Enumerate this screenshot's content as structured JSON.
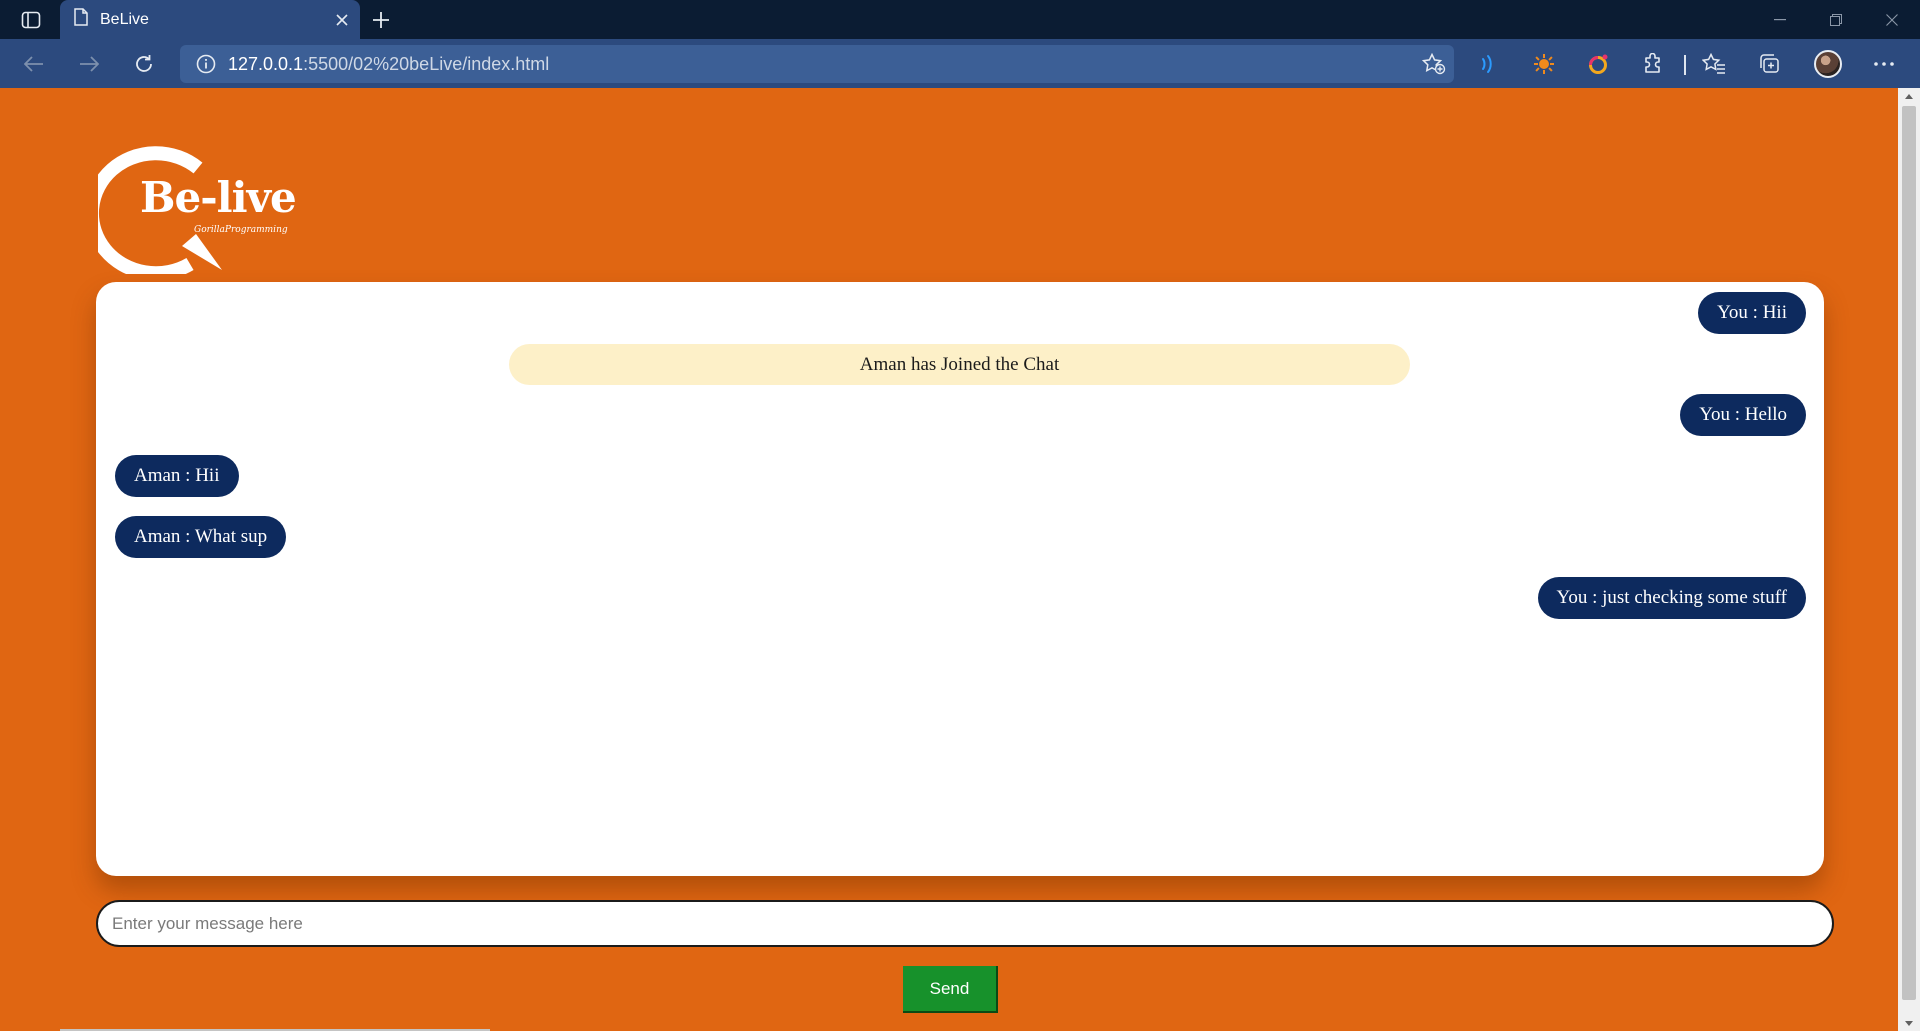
{
  "browser": {
    "tab_title": "BeLive",
    "url_host": "127.0.0.1",
    "url_path": ":5500/02%20beLive/index.html",
    "icons": [
      "tab-actions-icon",
      "page-icon",
      "close-icon",
      "plus-icon",
      "back-icon",
      "forward-icon",
      "refresh-icon",
      "info-icon",
      "add-favorite-icon",
      "read-aloud-icon",
      "extension-sun-icon",
      "extension-ring-icon",
      "extensions-icon",
      "favorites-icon",
      "collections-icon",
      "profile-avatar",
      "more-icon"
    ]
  },
  "app": {
    "logo_text": "Be-live",
    "logo_tagline": "GorillaProgramming"
  },
  "chat": {
    "messages": [
      {
        "side": "right",
        "text": "You : Hii"
      },
      {
        "side": "notice",
        "text": "Aman has Joined the Chat"
      },
      {
        "side": "right",
        "text": "You : Hello"
      },
      {
        "side": "left",
        "text": "Aman : Hii"
      },
      {
        "side": "left",
        "text": "Aman : What sup"
      },
      {
        "side": "right",
        "text": "You : just checking some stuff"
      }
    ]
  },
  "composer": {
    "placeholder": "Enter your message here",
    "value": "",
    "send_label": "Send"
  },
  "colors": {
    "page_bg": "#e06612",
    "bubble": "#0d2a5e",
    "notice": "#fdf0c8",
    "send": "#17912b"
  }
}
